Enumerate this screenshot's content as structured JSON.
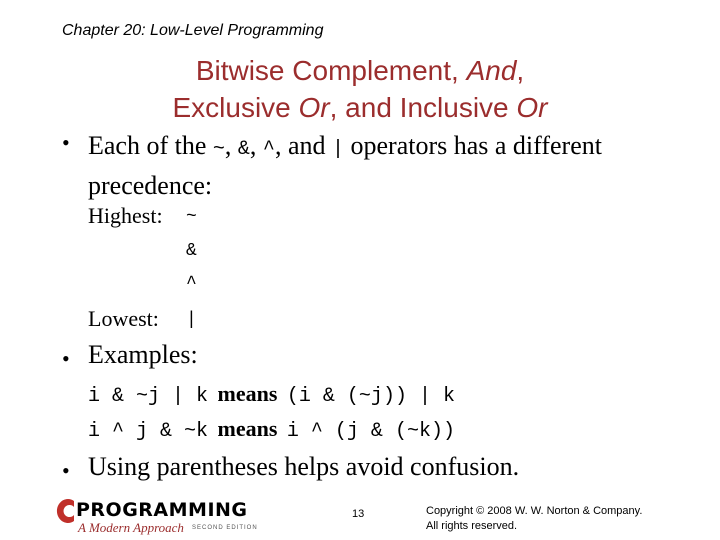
{
  "header": {
    "chapter": "Chapter 20: Low-Level Programming"
  },
  "title": {
    "line1_prefix": "Bitwise Complement, ",
    "line1_italic": "And",
    "line1_suffix": ",",
    "line2_a": "Exclusive ",
    "line2_b": "Or",
    "line2_c": ", and Inclusive ",
    "line2_d": "Or"
  },
  "bullets": {
    "b1": {
      "t1": "Each of the ",
      "op1": "~",
      "t2": ", ",
      "op2": "&",
      "t3": ", ",
      "op3": "^",
      "t4": ", and ",
      "op4": "|",
      "t5": " operators has a different precedence:"
    },
    "precedence": {
      "highest_label": "Highest:",
      "lowest_label": "Lowest:",
      "ops": [
        "~",
        "&",
        "^",
        "|"
      ]
    },
    "b2": {
      "label": "Examples:",
      "examples": [
        {
          "expr": "i & ~j | k",
          "means": "means",
          "result": "(i & (~j)) | k"
        },
        {
          "expr": "i ^ j & ~k",
          "means": "means",
          "result": "i ^ (j & (~k))"
        }
      ]
    },
    "b3": {
      "label": "Using parentheses helps avoid confusion."
    },
    "bullet_glyph": "•"
  },
  "footer": {
    "logo_letter": "C",
    "logo_text": "PROGRAMMING",
    "logo_subtitle": "A Modern Approach",
    "logo_edition": "SECOND EDITION",
    "page_number": "13",
    "copyright_line1": "Copyright © 2008 W. W. Norton & Company.",
    "copyright_line2": "All rights reserved."
  },
  "colors": {
    "title": "#9b2d2d",
    "logo_red": "#c0302a"
  }
}
